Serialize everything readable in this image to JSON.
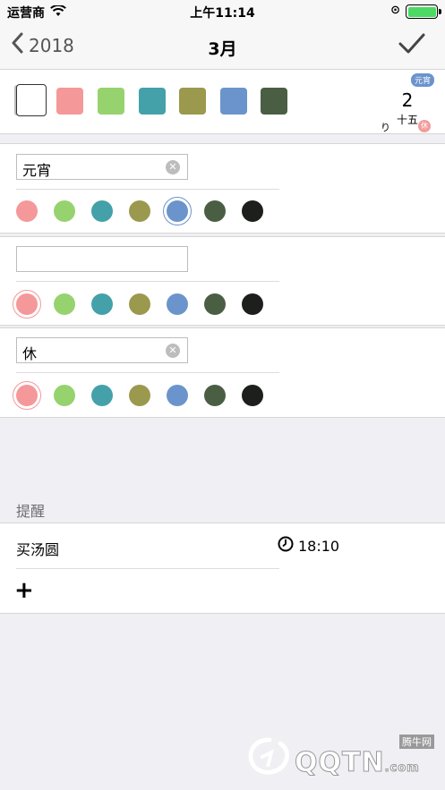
{
  "status": {
    "carrier": "运营商",
    "time": "上午11:14"
  },
  "nav": {
    "back_label": "2018",
    "title": "3月"
  },
  "colors": {
    "white": "#ffffff",
    "pink": "#f59899",
    "green": "#96d36e",
    "teal": "#44a1a9",
    "olive": "#9a994e",
    "blue": "#6b94cc",
    "dark_green": "#4a5e44",
    "black": "#1c1f1b"
  },
  "day_preview": {
    "day": "2",
    "lunar": "十五",
    "festival_tag": "元宵",
    "holiday_tag": "休",
    "mark": "り"
  },
  "tags": [
    {
      "text": "元宵",
      "selected_color": "blue"
    },
    {
      "text": "",
      "selected_color": "pink"
    },
    {
      "text": "休",
      "selected_color": "pink"
    }
  ],
  "reminder_section": {
    "header": "提醒",
    "items": [
      {
        "title": "买汤圆",
        "time": "18:10"
      }
    ],
    "add_label": "+"
  },
  "watermark": {
    "brand": "QQTN",
    "suffix": ".com",
    "tag": "腾牛网"
  }
}
